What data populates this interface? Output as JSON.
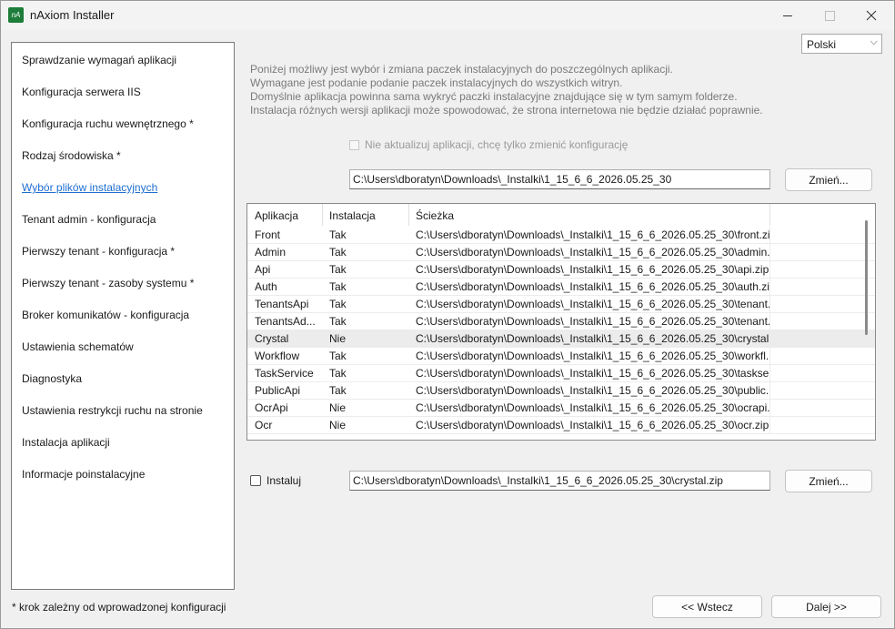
{
  "window": {
    "title": "nAxiom Installer",
    "icon_label": "nA"
  },
  "sidebar": {
    "items": [
      {
        "label": "Sprawdzanie wymagań aplikacji"
      },
      {
        "label": "Konfiguracja serwera IIS"
      },
      {
        "label": "Konfiguracja ruchu wewnętrznego *"
      },
      {
        "label": "Rodzaj środowiska *"
      },
      {
        "label": "Wybór plików instalacyjnych"
      },
      {
        "label": "Tenant admin - konfiguracja"
      },
      {
        "label": "Pierwszy tenant - konfiguracja *"
      },
      {
        "label": "Pierwszy tenant - zasoby systemu *"
      },
      {
        "label": "Broker komunikatów - konfiguracja"
      },
      {
        "label": "Ustawienia schematów"
      },
      {
        "label": "Diagnostyka"
      },
      {
        "label": "Ustawienia restrykcji ruchu na stronie"
      },
      {
        "label": "Instalacja aplikacji"
      },
      {
        "label": "Informacje poinstalacyjne"
      }
    ],
    "active_index": 4,
    "footnote": "* krok zależny od wprowadzonej konfiguracji"
  },
  "language": {
    "selected": "Polski"
  },
  "info_lines": [
    "Poniżej możliwy jest wybór i zmiana paczek instalacyjnych do poszczególnych aplikacji.",
    "Wymagane jest podanie podanie paczek instalacyjnych do wszystkich witryn.",
    "Domyślnie aplikacja powinna sama wykryć paczki instalacyjne znajdujące się w tym samym folderze.",
    "Instalacja różnych wersji aplikacji może spowodować, że strona internetowa nie będzie działać poprawnie."
  ],
  "no_update_checkbox": {
    "label": "Nie aktualizuj aplikacji, chcę tylko zmienić konfigurację",
    "checked": false,
    "disabled": true
  },
  "folder": {
    "path": "C:\\Users\\dboratyn\\Downloads\\_Instalki\\1_15_6_6_2026.05.25_30",
    "change_label": "Zmień..."
  },
  "table": {
    "headers": {
      "app": "Aplikacja",
      "install": "Instalacja",
      "path": "Ścieżka"
    },
    "rows": [
      {
        "app": "Front",
        "install": "Tak",
        "path": "C:\\Users\\dboratyn\\Downloads\\_Instalki\\1_15_6_6_2026.05.25_30\\front.zip"
      },
      {
        "app": "Admin",
        "install": "Tak",
        "path": "C:\\Users\\dboratyn\\Downloads\\_Instalki\\1_15_6_6_2026.05.25_30\\admin...."
      },
      {
        "app": "Api",
        "install": "Tak",
        "path": "C:\\Users\\dboratyn\\Downloads\\_Instalki\\1_15_6_6_2026.05.25_30\\api.zip"
      },
      {
        "app": "Auth",
        "install": "Tak",
        "path": "C:\\Users\\dboratyn\\Downloads\\_Instalki\\1_15_6_6_2026.05.25_30\\auth.zip"
      },
      {
        "app": "TenantsApi",
        "install": "Tak",
        "path": "C:\\Users\\dboratyn\\Downloads\\_Instalki\\1_15_6_6_2026.05.25_30\\tenant..."
      },
      {
        "app": "TenantsAd...",
        "install": "Tak",
        "path": "C:\\Users\\dboratyn\\Downloads\\_Instalki\\1_15_6_6_2026.05.25_30\\tenant..."
      },
      {
        "app": "Crystal",
        "install": "Nie",
        "path": "C:\\Users\\dboratyn\\Downloads\\_Instalki\\1_15_6_6_2026.05.25_30\\crystal...."
      },
      {
        "app": "Workflow",
        "install": "Tak",
        "path": "C:\\Users\\dboratyn\\Downloads\\_Instalki\\1_15_6_6_2026.05.25_30\\workfl..."
      },
      {
        "app": "TaskService",
        "install": "Tak",
        "path": "C:\\Users\\dboratyn\\Downloads\\_Instalki\\1_15_6_6_2026.05.25_30\\taskser..."
      },
      {
        "app": "PublicApi",
        "install": "Tak",
        "path": "C:\\Users\\dboratyn\\Downloads\\_Instalki\\1_15_6_6_2026.05.25_30\\public..."
      },
      {
        "app": "OcrApi",
        "install": "Nie",
        "path": "C:\\Users\\dboratyn\\Downloads\\_Instalki\\1_15_6_6_2026.05.25_30\\ocrapi...."
      },
      {
        "app": "Ocr",
        "install": "Nie",
        "path": "C:\\Users\\dboratyn\\Downloads\\_Instalki\\1_15_6_6_2026.05.25_30\\ocr.zip"
      }
    ],
    "selected_index": 6
  },
  "selected_item": {
    "install_label": "Instaluj",
    "install_checked": false,
    "path": "C:\\Users\\dboratyn\\Downloads\\_Instalki\\1_15_6_6_2026.05.25_30\\crystal.zip",
    "change_label": "Zmień..."
  },
  "nav": {
    "back_label": "<< Wstecz",
    "next_label": "Dalej >>"
  }
}
